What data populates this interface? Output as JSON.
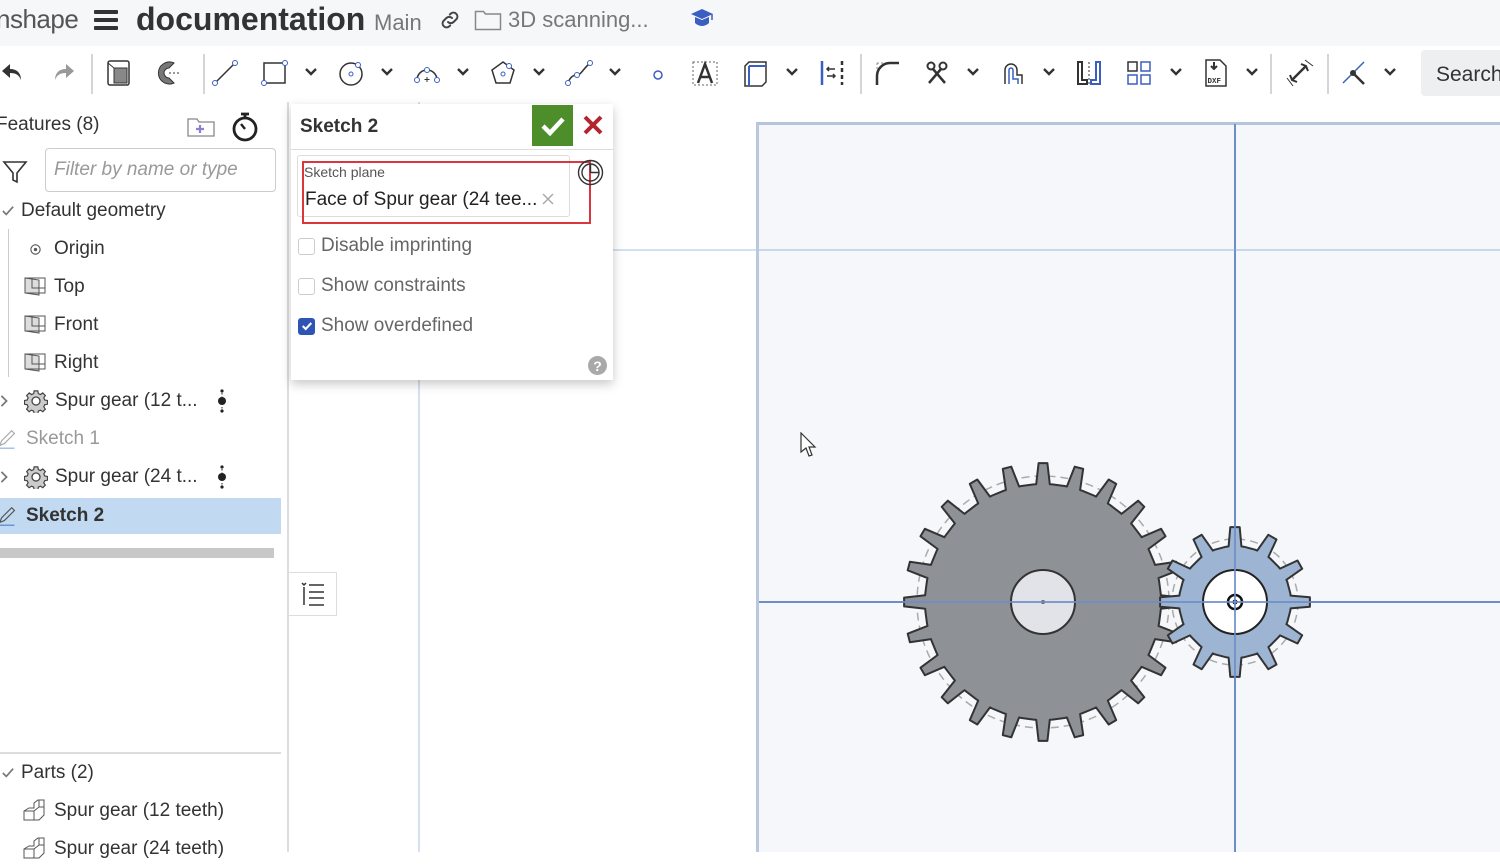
{
  "topbar": {
    "logo": "nshape",
    "document_title": "documentation",
    "branch": "Main",
    "folder_name": "3D scanning...",
    "icons": [
      "hamburger-menu-icon",
      "link-icon",
      "folder-icon",
      "learning-center-icon"
    ]
  },
  "toolbar": {
    "tools": [
      {
        "name": "undo",
        "icon": "undo-icon"
      },
      {
        "name": "redo",
        "icon": "redo-icon",
        "disabled": true
      },
      {
        "name": "sketch-mode",
        "icon": "sketch-mode-icon"
      },
      {
        "name": "show-section",
        "icon": "section-view-icon"
      },
      {
        "name": "line",
        "icon": "line-icon"
      },
      {
        "name": "rectangle",
        "icon": "rectangle-icon",
        "has_dropdown": true
      },
      {
        "name": "circle",
        "icon": "circle-icon",
        "has_dropdown": true
      },
      {
        "name": "arc",
        "icon": "arc-icon",
        "has_dropdown": true
      },
      {
        "name": "polygon",
        "icon": "polygon-icon",
        "has_dropdown": true
      },
      {
        "name": "spline",
        "icon": "spline-icon",
        "has_dropdown": true
      },
      {
        "name": "point",
        "icon": "point-icon"
      },
      {
        "name": "text",
        "icon": "text-icon"
      },
      {
        "name": "use",
        "icon": "use-icon",
        "has_dropdown": true
      },
      {
        "name": "offset",
        "icon": "offset-icon"
      },
      {
        "name": "fillet",
        "icon": "fillet-icon"
      },
      {
        "name": "trim",
        "icon": "trim-icon",
        "has_dropdown": true
      },
      {
        "name": "slot",
        "icon": "slot-icon",
        "has_dropdown": true
      },
      {
        "name": "mirror",
        "icon": "mirror-icon"
      },
      {
        "name": "pattern",
        "icon": "pattern-icon",
        "has_dropdown": true
      },
      {
        "name": "insert-dxf",
        "icon": "dxf-icon",
        "has_dropdown": true
      },
      {
        "name": "dimension",
        "icon": "dimension-icon"
      },
      {
        "name": "constraint",
        "icon": "coincident-icon",
        "has_dropdown": true
      }
    ],
    "search_label": "Search"
  },
  "feature_panel": {
    "title": "Features (8)",
    "filter_placeholder": "Filter by name or type",
    "items": [
      {
        "label": "Default geometry",
        "type": "group",
        "expanded": true
      },
      {
        "label": "Origin",
        "type": "origin"
      },
      {
        "label": "Top",
        "type": "plane"
      },
      {
        "label": "Front",
        "type": "plane"
      },
      {
        "label": "Right",
        "type": "plane"
      },
      {
        "label": "Spur gear (12 t...",
        "type": "custom-feature",
        "collapsed": true
      },
      {
        "label": "Sketch 1",
        "type": "sketch",
        "muted": true
      },
      {
        "label": "Spur gear (24 t...",
        "type": "custom-feature",
        "collapsed": true
      },
      {
        "label": "Sketch 2",
        "type": "sketch",
        "selected": true
      }
    ],
    "parts_title": "Parts (2)",
    "parts": [
      {
        "label": "Spur gear (12 teeth)"
      },
      {
        "label": "Spur gear (24 teeth)"
      }
    ]
  },
  "sketch_dialog": {
    "title": "Sketch 2",
    "sketch_plane_label": "Sketch plane",
    "sketch_plane_value": "Face of Spur gear (24 tee...",
    "options": [
      {
        "label": "Disable imprinting",
        "checked": false
      },
      {
        "label": "Show constraints",
        "checked": false
      },
      {
        "label": "Show overdefined",
        "checked": true
      }
    ]
  },
  "viewport": {
    "ghost_label": "Sketch 2",
    "gears": [
      {
        "name": "Spur gear (24 teeth)",
        "teeth": 24,
        "color": "#8e9196"
      },
      {
        "name": "Spur gear (12 teeth)",
        "teeth": 12,
        "color": "#9db4d2"
      }
    ]
  },
  "colors": {
    "accept": "#4d8e2a",
    "cancel": "#b1262e",
    "selection": "#c2daf1",
    "highlight": "#d9363e",
    "checkbox": "#2f55b4",
    "axis": "#6e8ec8"
  }
}
